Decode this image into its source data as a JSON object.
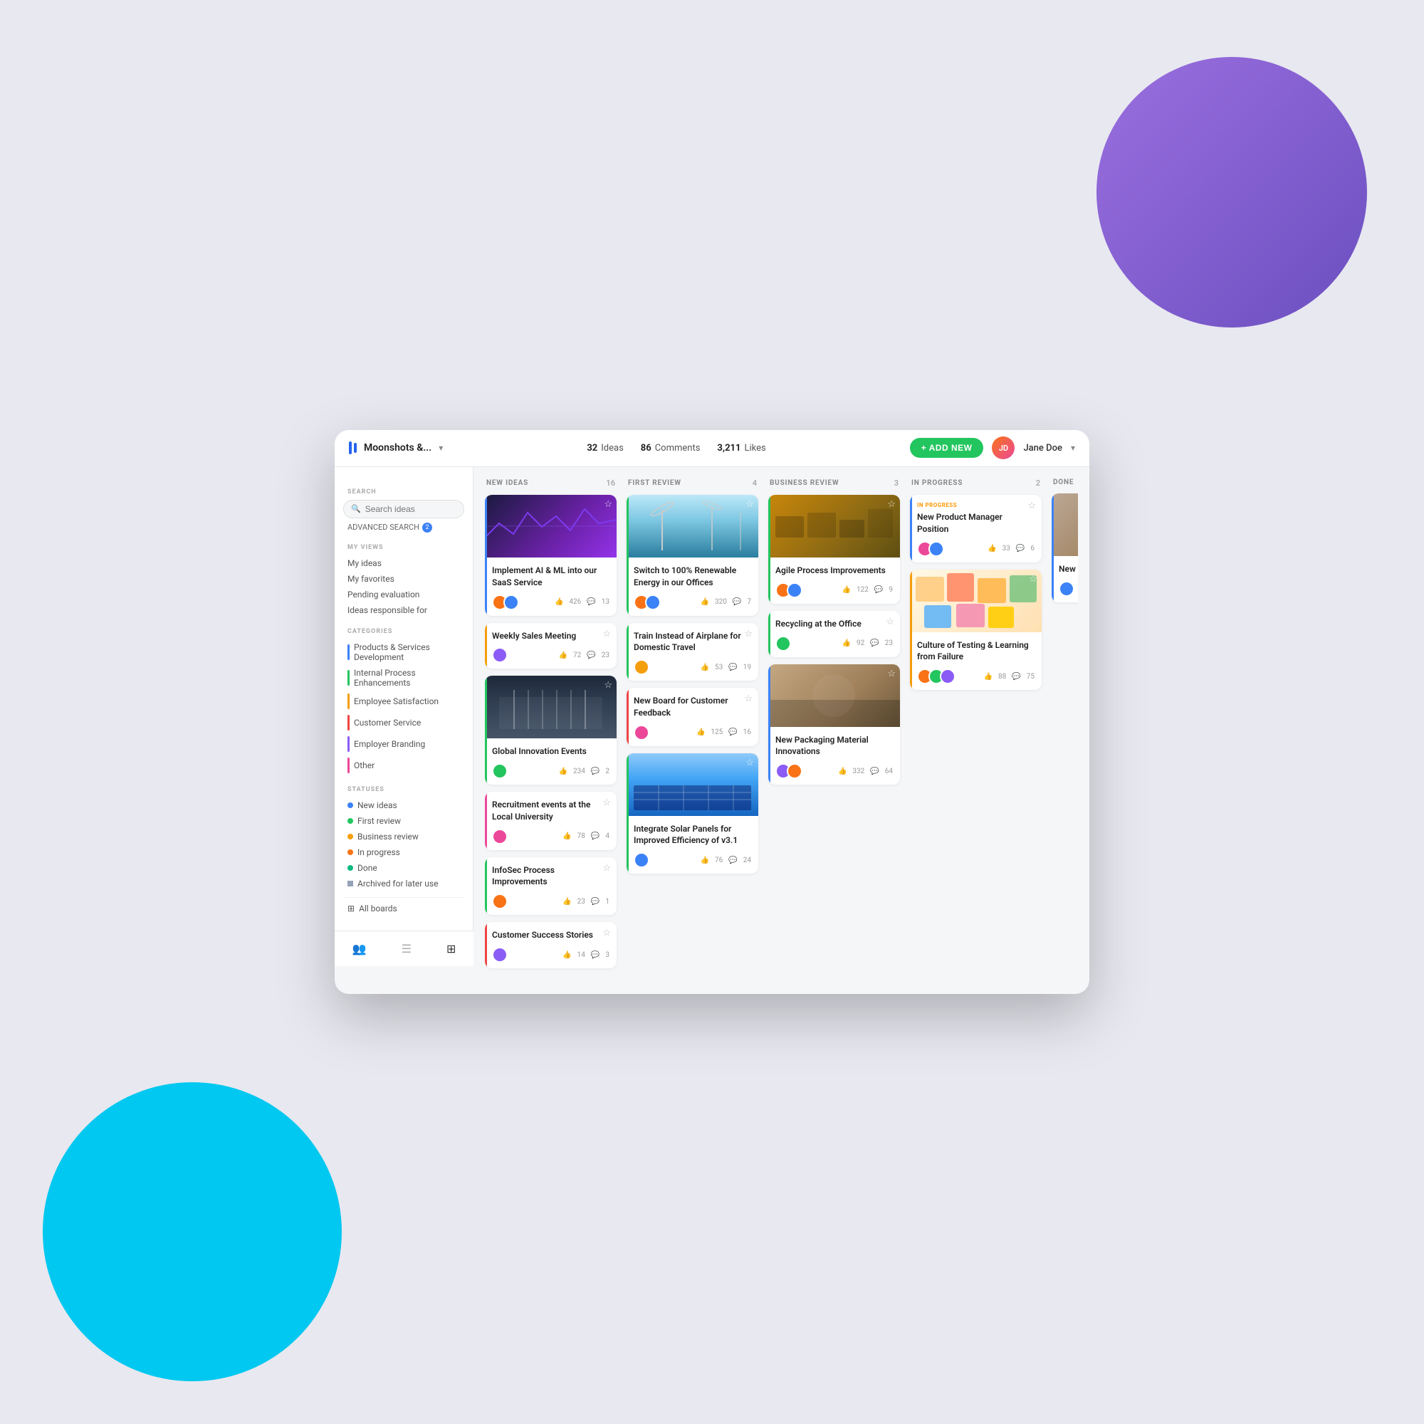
{
  "app": {
    "workspace": "Moonshots &...",
    "stats": {
      "ideas": "32",
      "ideas_label": "Ideas",
      "comments": "86",
      "comments_label": "Comments",
      "likes": "3,211",
      "likes_label": "Likes"
    },
    "add_new_label": "+ ADD NEW",
    "user_name": "Jane Doe",
    "user_initials": "JD"
  },
  "sidebar": {
    "search_placeholder": "Search ideas",
    "advanced_search_label": "ADVANCED SEARCH",
    "advanced_search_badge": "2",
    "my_views_label": "MY VIEWS",
    "my_views": [
      {
        "label": "My ideas"
      },
      {
        "label": "My favorites"
      },
      {
        "label": "Pending evaluation"
      },
      {
        "label": "Ideas responsible for"
      }
    ],
    "categories_label": "CATEGORIES",
    "categories": [
      {
        "label": "Products & Services Development",
        "color": "#3b82f6"
      },
      {
        "label": "Internal Process Enhancements",
        "color": "#22c55e"
      },
      {
        "label": "Employee Satisfaction",
        "color": "#f59e0b"
      },
      {
        "label": "Customer Service",
        "color": "#ef4444"
      },
      {
        "label": "Employer Branding",
        "color": "#8b5cf6"
      },
      {
        "label": "Other",
        "color": "#ec4899"
      }
    ],
    "statuses_label": "STATUSES",
    "statuses": [
      {
        "label": "New ideas",
        "color": "#3b82f6"
      },
      {
        "label": "First review",
        "color": "#22c55e"
      },
      {
        "label": "Business review",
        "color": "#f59e0b"
      },
      {
        "label": "In progress",
        "color": "#f97316"
      },
      {
        "label": "Done",
        "color": "#10b981"
      },
      {
        "label": "Archived for later use",
        "color": "#94a3b8"
      }
    ],
    "all_boards_label": "All boards",
    "bottom_nav": [
      "people-icon",
      "list-icon",
      "grid-icon"
    ]
  },
  "columns": [
    {
      "id": "new-ideas",
      "title": "NEW IDEAS",
      "count": "16",
      "cards": [
        {
          "id": "card-1",
          "title": "Implement AI & ML into our SaaS Service",
          "has_image": true,
          "image_type": "ai",
          "likes": "426",
          "comments": "13",
          "avatars": [
            {
              "color": "#f97316"
            },
            {
              "color": "#3b82f6"
            }
          ],
          "starred": false,
          "category_color": "#3b82f6"
        },
        {
          "id": "card-2",
          "title": "Weekly Sales Meeting",
          "has_image": false,
          "likes": "72",
          "comments": "23",
          "avatars": [
            {
              "color": "#8b5cf6"
            }
          ],
          "starred": false,
          "category_color": "#f59e0b"
        },
        {
          "id": "card-3",
          "title": "Global Innovation Events",
          "has_image": true,
          "image_type": "hall",
          "likes": "234",
          "comments": "2",
          "avatars": [
            {
              "color": "#22c55e"
            }
          ],
          "starred": false,
          "category_color": "#22c55e"
        },
        {
          "id": "card-4",
          "title": "Recruitment events at the Local University",
          "has_image": false,
          "likes": "78",
          "comments": "4",
          "avatars": [
            {
              "color": "#ec4899"
            }
          ],
          "starred": false,
          "category_color": "#ec4899"
        },
        {
          "id": "card-5",
          "title": "InfoSec Process Improvements",
          "has_image": false,
          "likes": "23",
          "comments": "1",
          "avatars": [
            {
              "color": "#f97316"
            }
          ],
          "starred": false,
          "category_color": "#22c55e"
        },
        {
          "id": "card-6",
          "title": "Customer Success Stories",
          "has_image": false,
          "likes": "14",
          "comments": "3",
          "avatars": [
            {
              "color": "#8b5cf6"
            }
          ],
          "starred": false,
          "category_color": "#ef4444"
        }
      ]
    },
    {
      "id": "first-review",
      "title": "FIRST REVIEW",
      "count": "4",
      "cards": [
        {
          "id": "card-7",
          "title": "Switch to 100% Renewable Energy in our Offices",
          "has_image": true,
          "image_type": "wind",
          "likes": "320",
          "comments": "7",
          "avatars": [
            {
              "color": "#f97316"
            },
            {
              "color": "#3b82f6"
            }
          ],
          "starred": false,
          "category_color": "#22c55e"
        },
        {
          "id": "card-8",
          "title": "Train Instead of Airplane for Domestic Travel",
          "has_image": false,
          "likes": "53",
          "comments": "19",
          "avatars": [
            {
              "color": "#f59e0b"
            }
          ],
          "starred": false,
          "category_color": "#22c55e"
        },
        {
          "id": "card-9",
          "title": "New Board for Customer Feedback",
          "has_image": false,
          "likes": "125",
          "comments": "16",
          "avatars": [
            {
              "color": "#ec4899"
            }
          ],
          "starred": false,
          "category_color": "#ef4444"
        },
        {
          "id": "card-10",
          "title": "Integrate Solar Panels for Improved Efficiency of v3.1",
          "has_image": true,
          "image_type": "solar",
          "likes": "76",
          "comments": "24",
          "avatars": [
            {
              "color": "#3b82f6"
            }
          ],
          "starred": false,
          "category_color": "#22c55e"
        }
      ]
    },
    {
      "id": "business-review",
      "title": "BUSINESS REVIEW",
      "count": "3",
      "cards": [
        {
          "id": "card-11",
          "title": "Agile Process Improvements",
          "has_image": true,
          "image_type": "boxes",
          "likes": "122",
          "comments": "9",
          "avatars": [
            {
              "color": "#f97316"
            },
            {
              "color": "#3b82f6"
            }
          ],
          "starred": false,
          "category_color": "#22c55e"
        },
        {
          "id": "card-12",
          "title": "Recycling at the Office",
          "has_image": false,
          "likes": "92",
          "comments": "23",
          "avatars": [
            {
              "color": "#22c55e"
            }
          ],
          "starred": false,
          "category_color": "#22c55e"
        },
        {
          "id": "card-13",
          "title": "New Packaging Material Innovations",
          "has_image": true,
          "image_type": "cardboard",
          "likes": "332",
          "comments": "64",
          "avatars": [
            {
              "color": "#8b5cf6"
            },
            {
              "color": "#f97316"
            }
          ],
          "starred": false,
          "category_color": "#3b82f6"
        }
      ]
    },
    {
      "id": "in-progress",
      "title": "IN PROGRESS",
      "count": "2",
      "cards": [
        {
          "id": "card-14",
          "title": "New Product Manager Position",
          "has_image": false,
          "status_badge": "IN PROGRESS",
          "status_badge_color": "#fff3e0",
          "status_badge_text_color": "#f97316",
          "likes": "33",
          "comments": "6",
          "avatars": [
            {
              "color": "#ec4899"
            },
            {
              "color": "#3b82f6"
            }
          ],
          "starred": false,
          "category_color": "#3b82f6"
        },
        {
          "id": "card-15",
          "title": "Culture of Testing & Learning from Failure",
          "has_image": true,
          "image_type": "sticky",
          "likes": "88",
          "comments": "75",
          "avatars": [
            {
              "color": "#f97316"
            },
            {
              "color": "#22c55e"
            },
            {
              "color": "#8b5cf6"
            }
          ],
          "starred": false,
          "category_color": "#f59e0b"
        }
      ]
    },
    {
      "id": "done",
      "title": "DONE",
      "count": "",
      "cards": [
        {
          "id": "card-16",
          "title": "New Pay...",
          "has_image": true,
          "image_type": "pkg",
          "likes": "",
          "comments": "",
          "avatars": [
            {
              "color": "#3b82f6"
            }
          ],
          "starred": false,
          "category_color": "#3b82f6",
          "partial": true
        }
      ]
    }
  ]
}
